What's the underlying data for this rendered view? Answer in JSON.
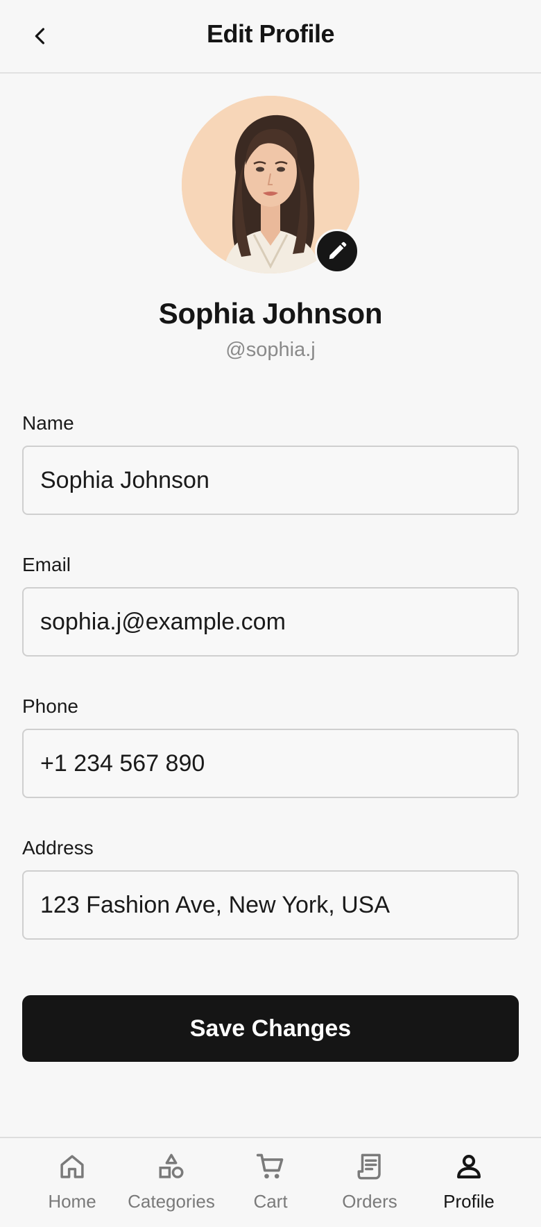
{
  "header": {
    "title": "Edit Profile",
    "back_icon": "chevron-left-icon"
  },
  "profile": {
    "name": "Sophia Johnson",
    "handle": "@sophia.j",
    "edit_icon": "pencil-icon"
  },
  "form": {
    "name": {
      "label": "Name",
      "value": "Sophia Johnson"
    },
    "email": {
      "label": "Email",
      "value": "sophia.j@example.com"
    },
    "phone": {
      "label": "Phone",
      "value": "+1 234 567 890"
    },
    "address": {
      "label": "Address",
      "value": "123 Fashion Ave, New York, USA"
    }
  },
  "save_button": {
    "label": "Save Changes"
  },
  "bottom_nav": {
    "active": "profile",
    "items": [
      {
        "id": "home",
        "label": "Home",
        "icon": "home-icon"
      },
      {
        "id": "categories",
        "label": "Categories",
        "icon": "shapes-icon"
      },
      {
        "id": "cart",
        "label": "Cart",
        "icon": "cart-icon"
      },
      {
        "id": "orders",
        "label": "Orders",
        "icon": "receipt-icon"
      },
      {
        "id": "profile",
        "label": "Profile",
        "icon": "user-icon"
      }
    ]
  },
  "colors": {
    "background": "#f7f7f7",
    "primary": "#151515",
    "muted_text": "#8a8a8a",
    "input_border": "#cfcfcf",
    "avatar_bg": "#f7d6b8"
  }
}
